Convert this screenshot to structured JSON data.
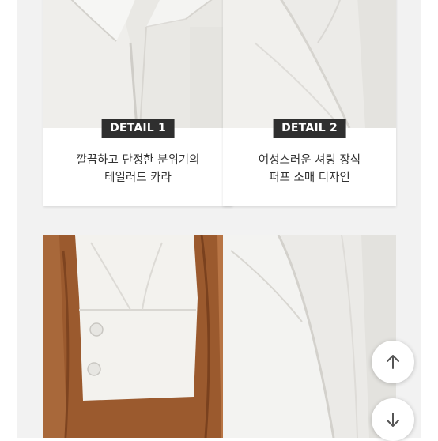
{
  "details": [
    {
      "badge": "DETAIL 1",
      "caption_line1": "깔끔하고 단정한 분위기의",
      "caption_line2": "테일러드 카라",
      "photo": "white-shirt-collar-closeup"
    },
    {
      "badge": "DETAIL 2",
      "caption_line1": "여성스러운 셔링 장식",
      "caption_line2": "퍼프 소매 디자인",
      "photo": "white-shirt-shirring-closeup"
    }
  ],
  "gallery": [
    {
      "photo": "white-shirt-cuff-on-wood"
    },
    {
      "photo": "white-shirt-sleeve-closeup"
    }
  ],
  "scroll_controls": {
    "up_icon": "arrow-up-icon",
    "down_icon": "arrow-down-icon"
  },
  "colors": {
    "panel_bg": "#f2f2f2",
    "badge_bg": "#2f2f2f",
    "badge_text": "#ffffff",
    "caption_text": "#333333"
  }
}
